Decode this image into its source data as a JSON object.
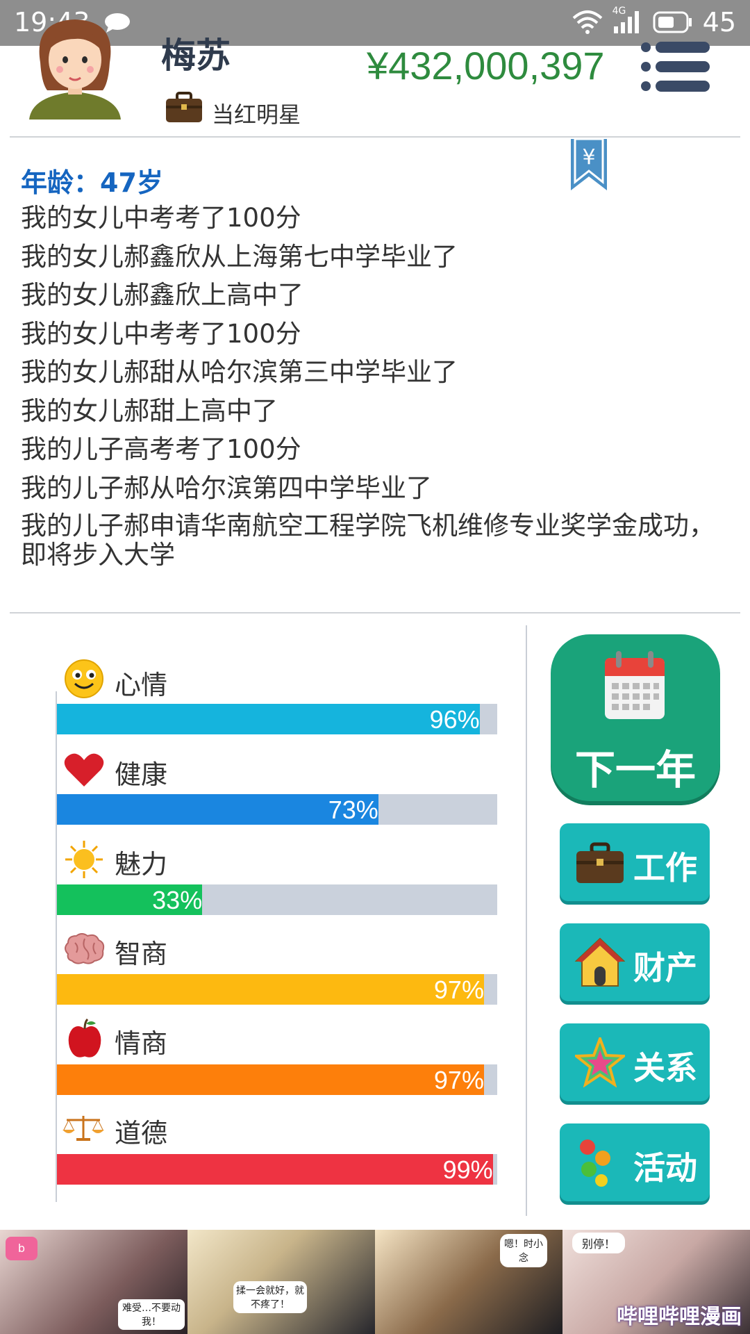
{
  "statusbar": {
    "time": "19:43",
    "network": "4G",
    "battery": "45"
  },
  "profile": {
    "name": "梅苏",
    "job": "当红明星",
    "money": "¥432,000,397"
  },
  "log": {
    "age": "年龄：47岁",
    "entries": [
      "我的女儿中考考了100分",
      "我的女儿郝鑫欣从上海第七中学毕业了",
      "我的女儿郝鑫欣上高中了",
      "我的女儿中考考了100分",
      "我的女儿郝甜从哈尔滨第三中学毕业了",
      "我的女儿郝甜上高中了",
      "我的儿子高考考了100分",
      "我的儿子郝从哈尔滨第四中学毕业了",
      "我的儿子郝申请华南航空工程学院飞机维修专业奖学金成功，即将步入大学"
    ]
  },
  "stats": [
    {
      "label": "心情",
      "icon": "smiley-icon",
      "value": 0.96,
      "text": "96%",
      "color": "#15b4dd"
    },
    {
      "label": "健康",
      "icon": "heart-icon",
      "value": 0.73,
      "text": "73%",
      "color": "#1a86e0"
    },
    {
      "label": "魅力",
      "icon": "sun-icon",
      "value": 0.33,
      "text": "33%",
      "color": "#14c15c"
    },
    {
      "label": "智商",
      "icon": "brain-icon",
      "value": 0.97,
      "text": "97%",
      "color": "#fdb910"
    },
    {
      "label": "情商",
      "icon": "apple-icon",
      "value": 0.97,
      "text": "97%",
      "color": "#fd7f0b"
    },
    {
      "label": "道德",
      "icon": "scales-icon",
      "value": 0.99,
      "text": "99%",
      "color": "#ee3342"
    }
  ],
  "actions": {
    "next_year": "下一年",
    "work": "工作",
    "assets": "财产",
    "relations": "关系",
    "activities": "活动"
  },
  "ad": {
    "caption": "哔哩哔哩漫画",
    "bubbles": [
      "难受…不要动我！",
      "揉一会就好，就不疼了！",
      "嗯！时小念",
      "别停！"
    ]
  },
  "colors": {
    "money": "#2e8b3e",
    "age": "#1565c0",
    "next_year_bg": "#1aa37a",
    "side_btn_bg": "#1bb8b8"
  }
}
